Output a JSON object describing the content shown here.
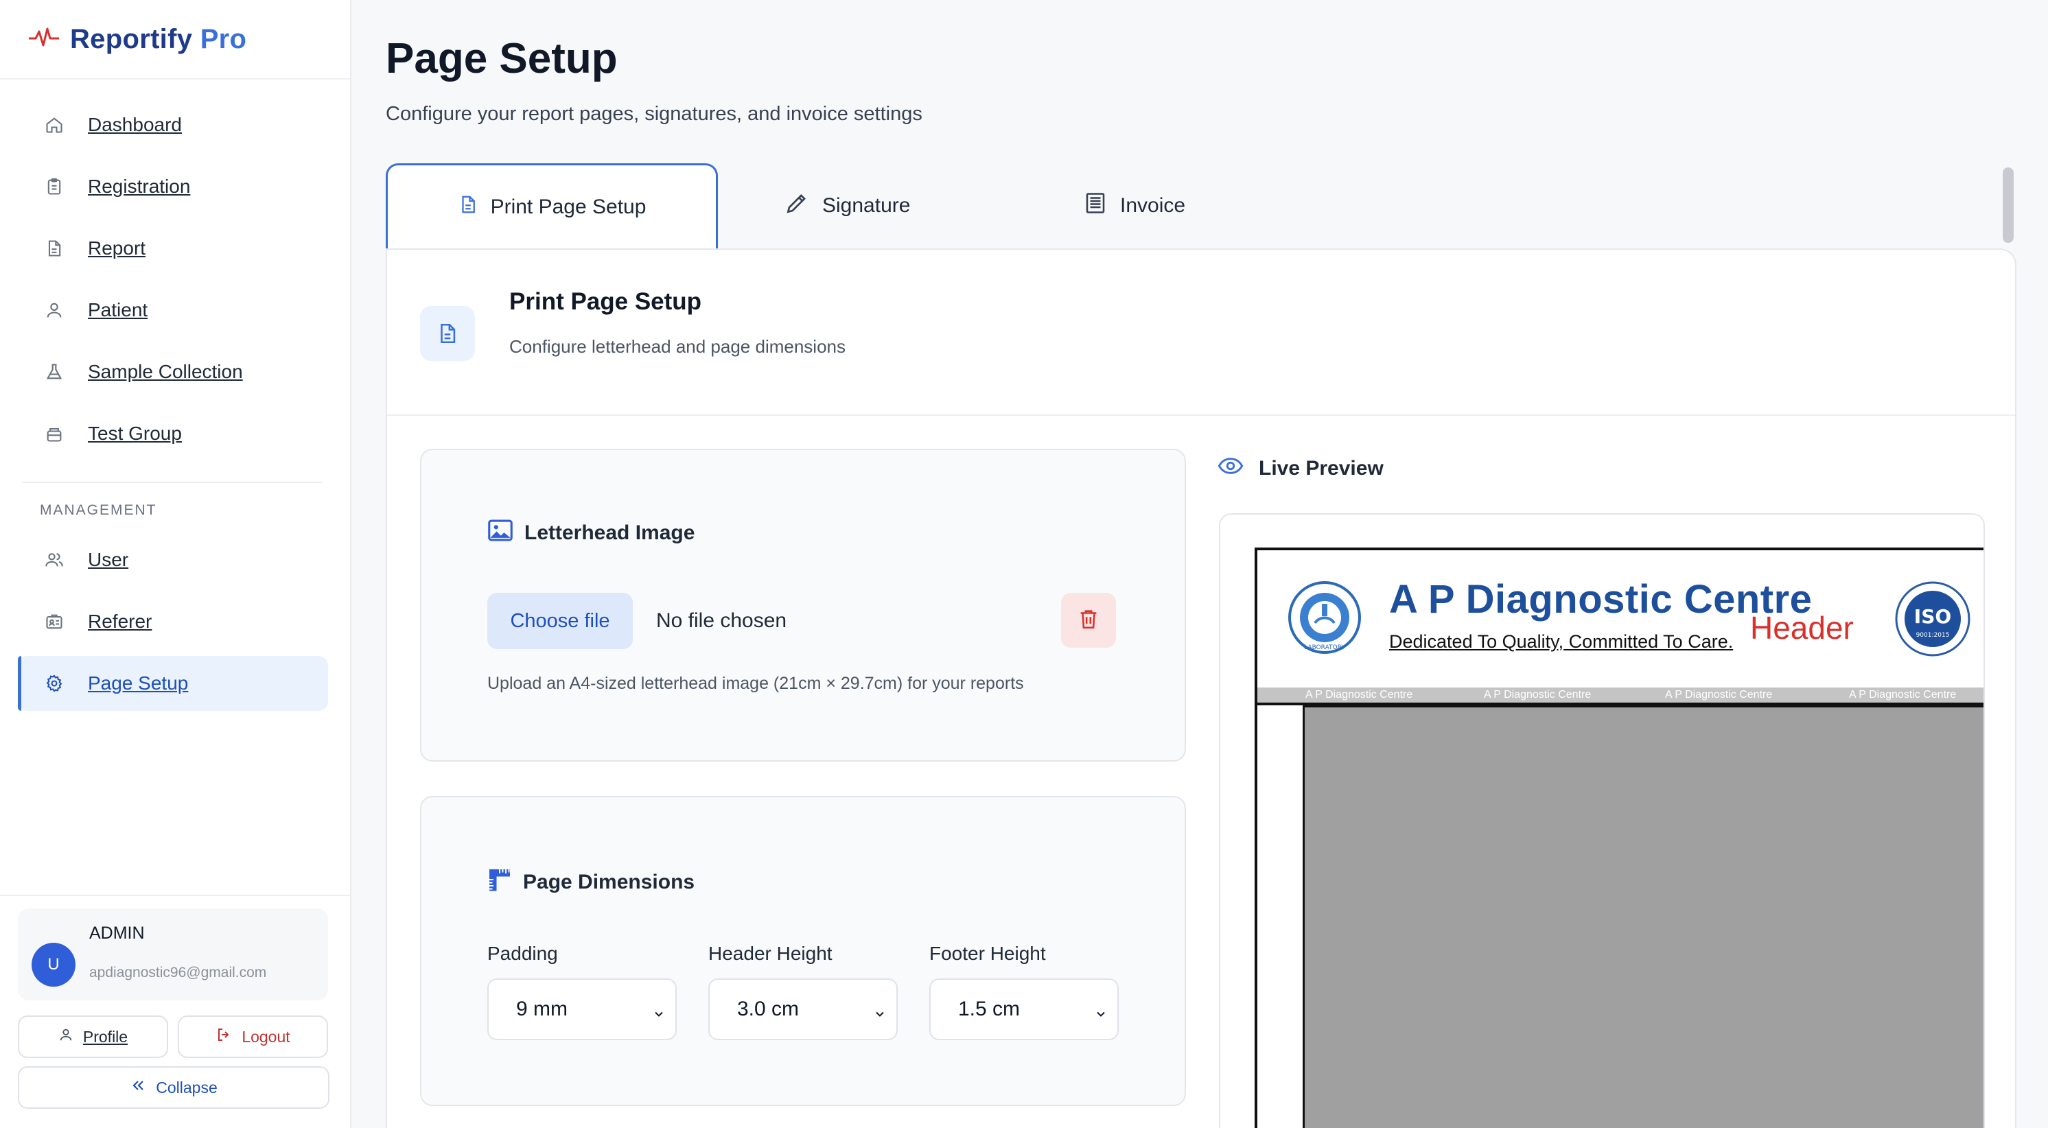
{
  "brand": {
    "name": "Reportify",
    "suffix": "Pro"
  },
  "sidebar": {
    "items": [
      {
        "label": "Dashboard",
        "icon": "home-icon"
      },
      {
        "label": "Registration",
        "icon": "clipboard-icon"
      },
      {
        "label": "Report",
        "icon": "file-icon"
      },
      {
        "label": "Patient",
        "icon": "user-icon"
      },
      {
        "label": "Sample Collection",
        "icon": "flask-icon"
      },
      {
        "label": "Test Group",
        "icon": "stack-icon"
      }
    ],
    "management_label": "MANAGEMENT",
    "management_items": [
      {
        "label": "User",
        "icon": "users-icon"
      },
      {
        "label": "Referer",
        "icon": "id-card-icon"
      },
      {
        "label": "Page Setup",
        "icon": "gear-icon",
        "active": true
      }
    ]
  },
  "user": {
    "avatar_letter": "U",
    "role": "ADMIN",
    "email": "apdiagnostic96@gmail.com",
    "profile_label": "Profile",
    "logout_label": "Logout",
    "collapse_label": "Collapse"
  },
  "page": {
    "title": "Page Setup",
    "subtitle": "Configure your report pages, signatures, and invoice settings"
  },
  "tabs": [
    {
      "label": "Print Page Setup",
      "active": true
    },
    {
      "label": "Signature"
    },
    {
      "label": "Invoice"
    }
  ],
  "panel": {
    "title": "Print Page Setup",
    "subtitle": "Configure letterhead and page dimensions"
  },
  "letterhead": {
    "title": "Letterhead Image",
    "choose_label": "Choose file",
    "file_status": "No file chosen",
    "hint": "Upload an A4-sized letterhead image (21cm × 29.7cm) for your reports"
  },
  "dimensions": {
    "title": "Page Dimensions",
    "padding_label": "Padding",
    "padding_value": "9 mm",
    "header_label": "Header Height",
    "header_value": "3.0 cm",
    "footer_label": "Footer Height",
    "footer_value": "1.5 cm"
  },
  "preview": {
    "title": "Live Preview",
    "letterhead_name": "A P Diagnostic Centre",
    "letterhead_tagline": "Dedicated To Quality, Committed To Care.",
    "header_marker": "Header",
    "strip_text": "A P Diagnostic Centre",
    "seal_text": "ISO",
    "seal_caption": "9001:2015",
    "logo_text": "LABORATORY"
  },
  "colors": {
    "accent": "#3b6fd8",
    "brand": "#1e3a8a",
    "danger": "#c53030",
    "active_bg": "#eaf2fd"
  }
}
